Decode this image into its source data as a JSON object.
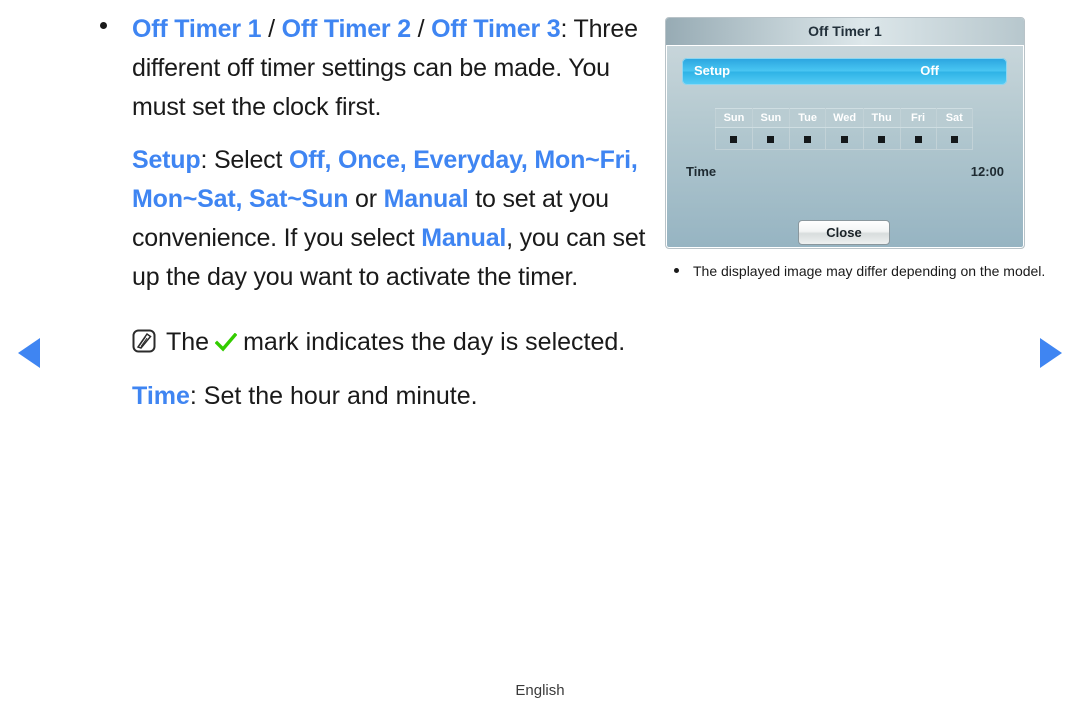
{
  "nav": {
    "prev_icon": "triangle-left-icon",
    "next_icon": "triangle-right-icon",
    "accent_color": "#3f85f2"
  },
  "content": {
    "bullet_marker": "•",
    "heading": {
      "item1": "Off Timer 1",
      "sep1": " / ",
      "item2": "Off Timer 2",
      "sep2": " / ",
      "item3": "Off Timer 3",
      "colon": ":"
    },
    "paragraph1": "Three different off timer settings can be made. You must set the clock first.",
    "setup_paragraph": {
      "label": "Setup",
      "label_colon": ": Select ",
      "options": "Off, Once, Everyday, Mon~Fri, Mon~Sat, Sat~Sun",
      "conj": " or ",
      "manual": "Manual",
      "tail1": " to set at you convenience. If you select ",
      "manual2": "Manual",
      "tail2": ", you can set up the day you want to activate the timer."
    },
    "note": {
      "icon": "note-pen-icon",
      "prefix": "The",
      "check_icon": "green-check-icon",
      "text": "mark indicates the day is selected."
    },
    "time_line": {
      "label": "Time",
      "text": ": Set the hour and minute."
    }
  },
  "tv_panel": {
    "title": "Off Timer 1",
    "setup_row": {
      "label": "Setup",
      "value": "Off"
    },
    "days": [
      {
        "name": "Sun",
        "mark": "■"
      },
      {
        "name": "Sun",
        "mark": "■"
      },
      {
        "name": "Tue",
        "mark": "■"
      },
      {
        "name": "Wed",
        "mark": "■"
      },
      {
        "name": "Thu",
        "mark": "■"
      },
      {
        "name": "Fri",
        "mark": "■"
      },
      {
        "name": "Sat",
        "mark": "■"
      }
    ],
    "time_row": {
      "label": "Time",
      "value": "12:00"
    },
    "close_label": "Close"
  },
  "side_note": {
    "bullet": "•",
    "text": "The displayed image may differ depending on the model."
  },
  "footer": {
    "language": "English"
  },
  "colors": {
    "link_blue": "#3f85f2",
    "check_green": "#33cc00",
    "panel_blue": "#2aa4df"
  }
}
